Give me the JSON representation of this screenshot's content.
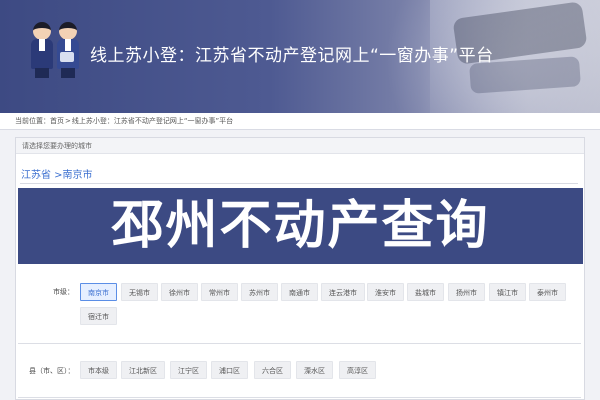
{
  "banner": {
    "title": "线上苏小登：江苏省不动产登记网上“一窗办事”平台"
  },
  "breadcrumb": {
    "prefix": "当前位置：",
    "items": [
      "首页",
      "线上苏小登：江苏省不动产登记网上“一窗办事”平台"
    ],
    "separator": ">"
  },
  "panel": {
    "header": "请选择您要办理的城市",
    "region": "江苏省 >南京市"
  },
  "overlay": {
    "text": "邳州不动产查询"
  },
  "city_filter": {
    "label": "市级：",
    "selected": "南京市",
    "options": [
      "南京市",
      "无锡市",
      "徐州市",
      "常州市",
      "苏州市",
      "南通市",
      "连云港市",
      "淮安市",
      "盐城市",
      "扬州市",
      "镇江市",
      "泰州市",
      "宿迁市"
    ]
  },
  "county_filter": {
    "label": "县（市、区）：",
    "options": [
      "市本级",
      "江北新区",
      "江宁区",
      "浦口区",
      "六合区",
      "溧水区",
      "高淳区"
    ]
  },
  "colors": {
    "banner": "#3d4a83",
    "accent": "#3b6fd0",
    "overlay": "#3c4a83"
  }
}
